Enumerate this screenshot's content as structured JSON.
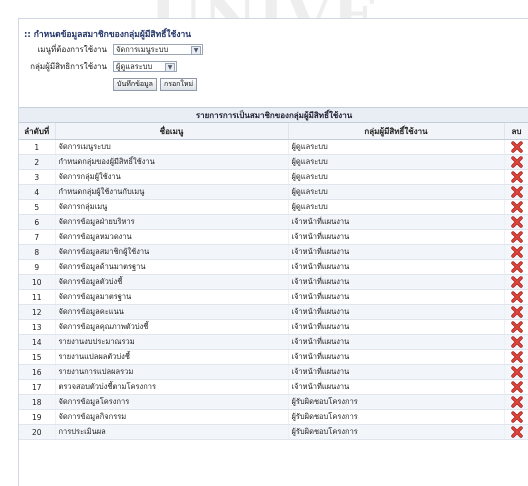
{
  "form": {
    "heading": ":: กำหนดข้อมูลสมาชิกของกลุ่มผู้มีสิทธิ์ใช้งาน",
    "menu_label": "เมนูที่ต้องการใช้งาน",
    "menu_value": "จัดการเมนูระบบ",
    "group_label": "กลุ่มผู้มีสิทธิการใช้งาน",
    "group_value": "ผู้ดูแลระบบ",
    "save_label": "บันทึกข้อมูล",
    "reset_label": "กรอกใหม่"
  },
  "table": {
    "title": "รายการการเป็นสมาชิกของกลุ่มผู้มีสิทธิ์ใช้งาน",
    "headers": [
      "ลำดับที่",
      "ชื่อเมนู",
      "กลุ่มผู้มีสิทธิ์ใช้งาน",
      "ลบ"
    ],
    "rows": [
      {
        "no": "1",
        "menu": "จัดการเมนูระบบ",
        "group": "ผู้ดูแลระบบ"
      },
      {
        "no": "2",
        "menu": "กำหนดกลุ่มของผู้มีสิทธิ์ใช้งาน",
        "group": "ผู้ดูแลระบบ"
      },
      {
        "no": "3",
        "menu": "จัดการกลุ่มผู้ใช้งาน",
        "group": "ผู้ดูแลระบบ"
      },
      {
        "no": "4",
        "menu": "กำหนดกลุ่มผู้ใช้งานกับเมนู",
        "group": "ผู้ดูแลระบบ"
      },
      {
        "no": "5",
        "menu": "จัดการกลุ่มเมนู",
        "group": "ผู้ดูแลระบบ"
      },
      {
        "no": "6",
        "menu": "จัดการข้อมูลฝ่ายบริหาร",
        "group": "เจ้าหน้าที่แผนงาน"
      },
      {
        "no": "7",
        "menu": "จัดการข้อมูลหมวดงาน",
        "group": "เจ้าหน้าที่แผนงาน"
      },
      {
        "no": "8",
        "menu": "จัดการข้อมูลสมาชิกผู้ใช้งาน",
        "group": "เจ้าหน้าที่แผนงาน"
      },
      {
        "no": "9",
        "menu": "จัดการข้อมูลด้านมาตรฐาน",
        "group": "เจ้าหน้าที่แผนงาน"
      },
      {
        "no": "10",
        "menu": "จัดการข้อมูลตัวบ่งชี้",
        "group": "เจ้าหน้าที่แผนงาน"
      },
      {
        "no": "11",
        "menu": "จัดการข้อมูลมาตรฐาน",
        "group": "เจ้าหน้าที่แผนงาน"
      },
      {
        "no": "12",
        "menu": "จัดการข้อมูลคะแนน",
        "group": "เจ้าหน้าที่แผนงาน"
      },
      {
        "no": "13",
        "menu": "จัดการข้อมูลคุณภาพตัวบ่งชี้",
        "group": "เจ้าหน้าที่แผนงาน"
      },
      {
        "no": "14",
        "menu": "รายงานงบประมาณรวม",
        "group": "เจ้าหน้าที่แผนงาน"
      },
      {
        "no": "15",
        "menu": "รายงานแปลผลตัวบ่งชี้",
        "group": "เจ้าหน้าที่แผนงาน"
      },
      {
        "no": "16",
        "menu": "รายงานการแปลผลรวม",
        "group": "เจ้าหน้าที่แผนงาน"
      },
      {
        "no": "17",
        "menu": "ตรวจสอบตัวบ่งชี้ตามโครงการ",
        "group": "เจ้าหน้าที่แผนงาน"
      },
      {
        "no": "18",
        "menu": "จัดการข้อมูลโครงการ",
        "group": "ผู้รับผิดชอบโครงการ"
      },
      {
        "no": "19",
        "menu": "จัดการข้อมูลกิจกรรม",
        "group": "ผู้รับผิดชอบโครงการ"
      },
      {
        "no": "20",
        "menu": "การประเมินผล",
        "group": "ผู้รับผิดชอบโครงการ"
      }
    ]
  },
  "icons": {
    "delete": "delete-x-icon",
    "dropdown": "dropdown-arrow-icon"
  },
  "colors": {
    "delete_red": "#d8322a",
    "header_bg": "#e9eef5",
    "row_alt": "#f2f5fa"
  }
}
